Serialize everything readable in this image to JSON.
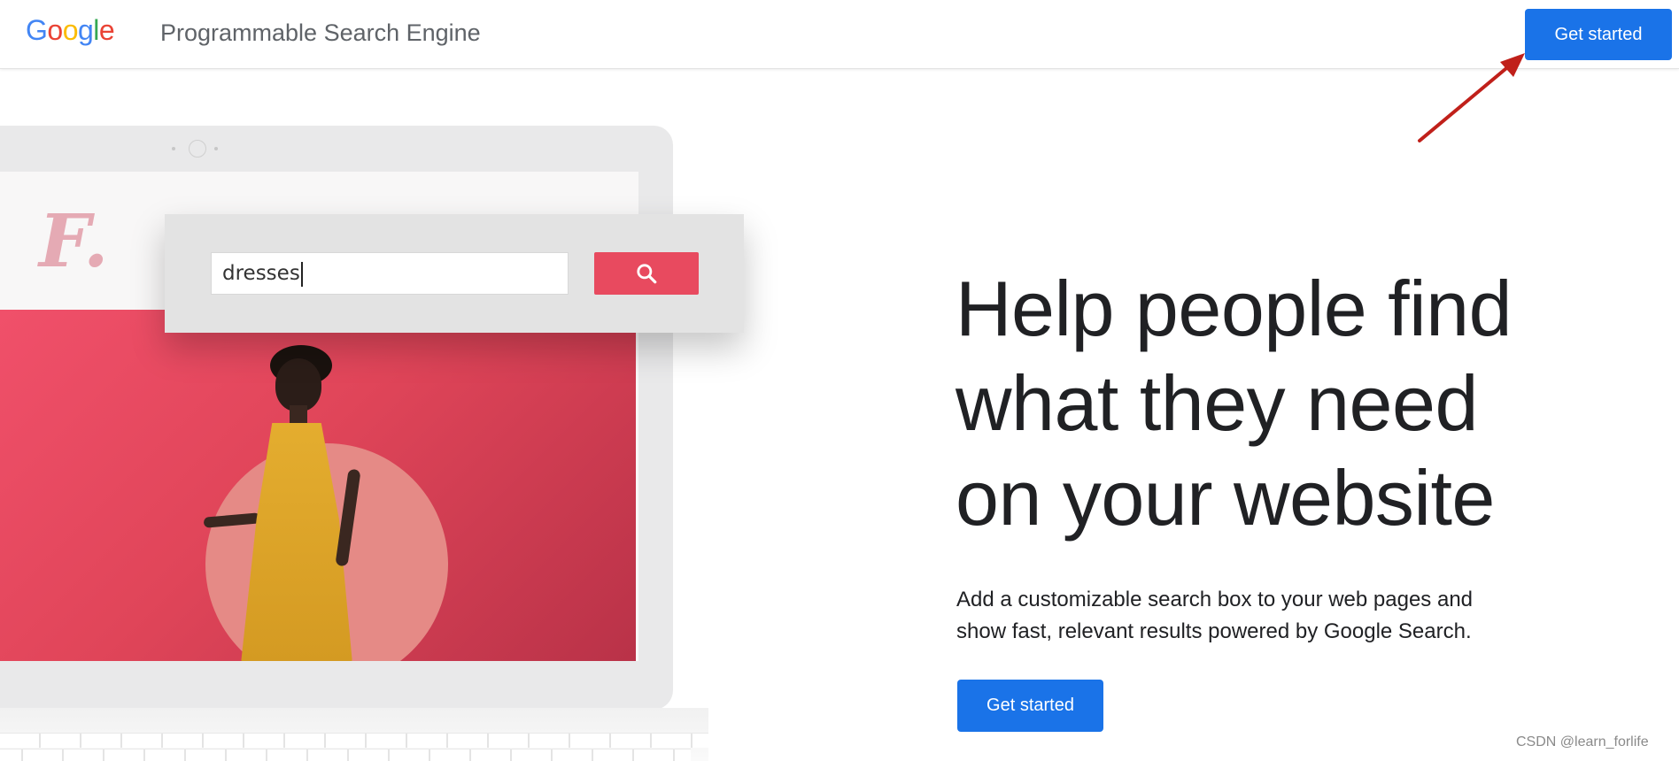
{
  "header": {
    "logo_letters": [
      {
        "char": "G",
        "color": "#4285F4"
      },
      {
        "char": "o",
        "color": "#EA4335"
      },
      {
        "char": "o",
        "color": "#FBBC05"
      },
      {
        "char": "g",
        "color": "#4285F4"
      },
      {
        "char": "l",
        "color": "#34A853"
      },
      {
        "char": "e",
        "color": "#EA4335"
      }
    ],
    "product_name": "Programmable Search Engine",
    "cta_label": "Get started"
  },
  "illustration": {
    "brand_mark": "F.",
    "search_value": "dresses",
    "search_icon": "search-icon"
  },
  "hero": {
    "headline_lines": [
      "Help people find",
      "what they need",
      "on your website"
    ],
    "subtext_lines": [
      "Add a customizable search box to your web pages and",
      "show fast, relevant results powered by Google Search."
    ],
    "cta_label": "Get started"
  },
  "watermark": "CSDN @learn_forlife",
  "colors": {
    "primary": "#1a73e8",
    "search_button": "#e84a5f",
    "annotation_arrow": "#c0201a"
  }
}
